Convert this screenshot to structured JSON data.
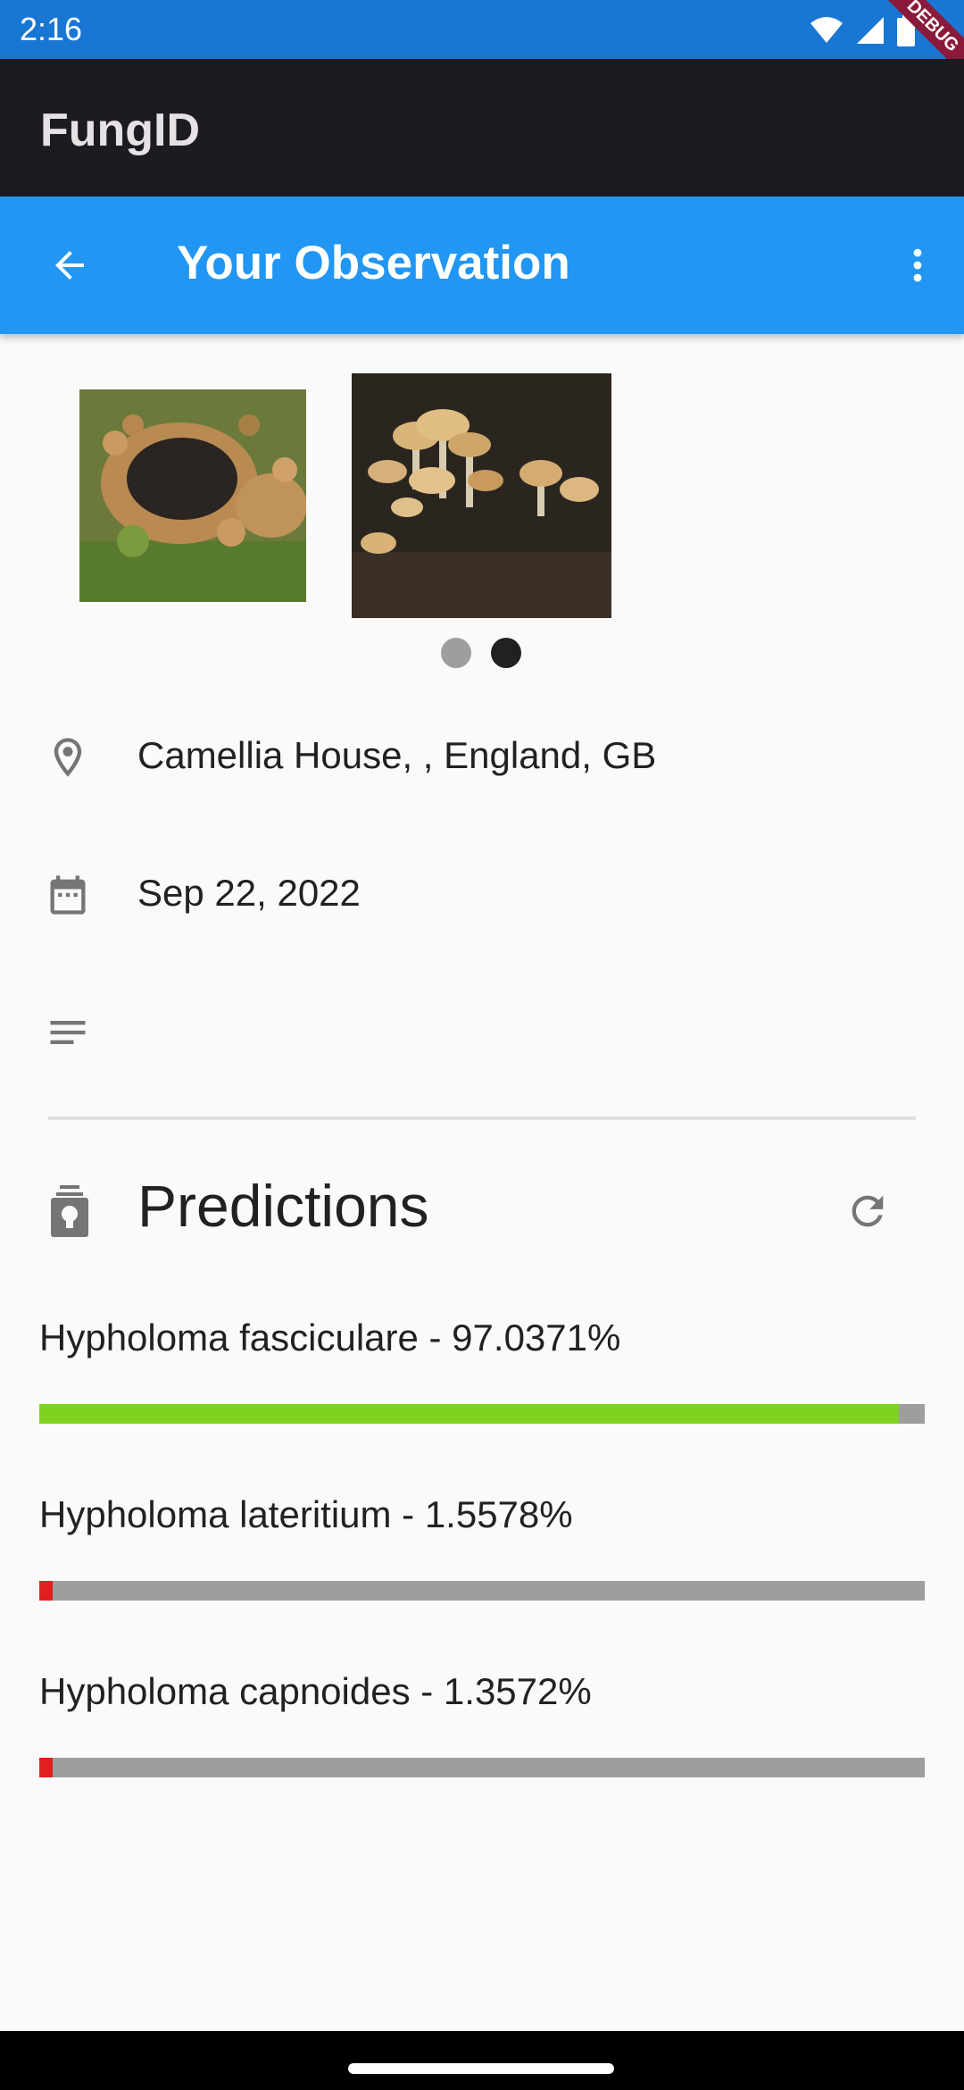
{
  "status_bar": {
    "time": "2:16",
    "icons": [
      "wifi-icon",
      "signal-icon",
      "battery-icon"
    ],
    "debug_banner": "DEBUG"
  },
  "app": {
    "title": "FungID"
  },
  "toolbar": {
    "title": "Your Observation",
    "back_icon": "arrow-back-icon",
    "menu_icon": "more-vert-icon"
  },
  "photos": {
    "items": [
      "photo-1",
      "photo-2"
    ],
    "active_index": 1
  },
  "observation": {
    "location": "Camellia House, , England, GB",
    "date": "Sep 22, 2022",
    "notes": ""
  },
  "predictions": {
    "title": "Predictions",
    "items": [
      {
        "label": "Hypholoma fasciculare - 97.0371%",
        "value": 0.970371,
        "color": "#7ed321"
      },
      {
        "label": "Hypholoma lateritium - 1.5578%",
        "value": 0.015578,
        "color": "#e02020"
      },
      {
        "label": "Hypholoma capnoides - 1.3572%",
        "value": 0.013572,
        "color": "#e02020"
      }
    ]
  },
  "colors": {
    "status_bar": "#1976d2",
    "app_bar": "#1c1b1f",
    "toolbar": "#2196f3",
    "track": "#9e9e9e",
    "high_confidence": "#7ed321",
    "low_confidence": "#e02020"
  }
}
